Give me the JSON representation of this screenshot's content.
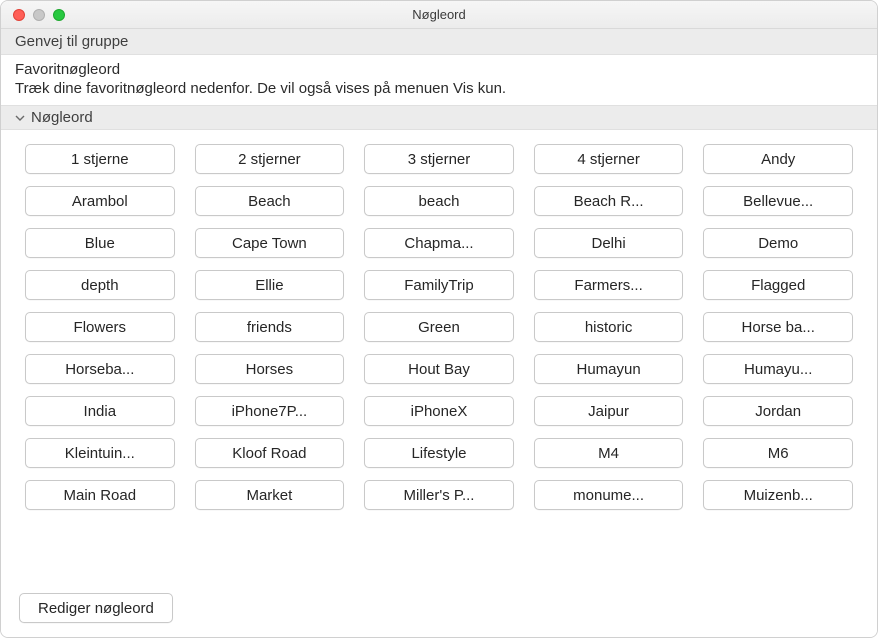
{
  "window": {
    "title": "Nøgleord"
  },
  "sections": {
    "shortcut_header": "Genvej til gruppe",
    "favorites_title": "Favoritnøgleord",
    "favorites_sub": "Træk dine favoritnøgleord nedenfor. De vil også vises på menuen Vis kun.",
    "keywords_header": "Nøgleord"
  },
  "keywords": [
    "1 stjerne",
    "2 stjerner",
    "3 stjerner",
    "4 stjerner",
    "Andy",
    "Arambol",
    "Beach",
    "beach",
    "Beach R...",
    "Bellevue...",
    "Blue",
    "Cape Town",
    "Chapma...",
    "Delhi",
    "Demo",
    "depth",
    "Ellie",
    "FamilyTrip",
    "Farmers...",
    "Flagged",
    "Flowers",
    "friends",
    "Green",
    "historic",
    "Horse ba...",
    "Horseba...",
    "Horses",
    "Hout Bay",
    "Humayun",
    "Humayu...",
    "India",
    "iPhone7P...",
    "iPhoneX",
    "Jaipur",
    "Jordan",
    "Kleintuin...",
    "Kloof Road",
    "Lifestyle",
    "M4",
    "M6",
    "Main Road",
    "Market",
    "Miller's P...",
    "monume...",
    "Muizenb..."
  ],
  "footer": {
    "edit_label": "Rediger nøgleord"
  }
}
